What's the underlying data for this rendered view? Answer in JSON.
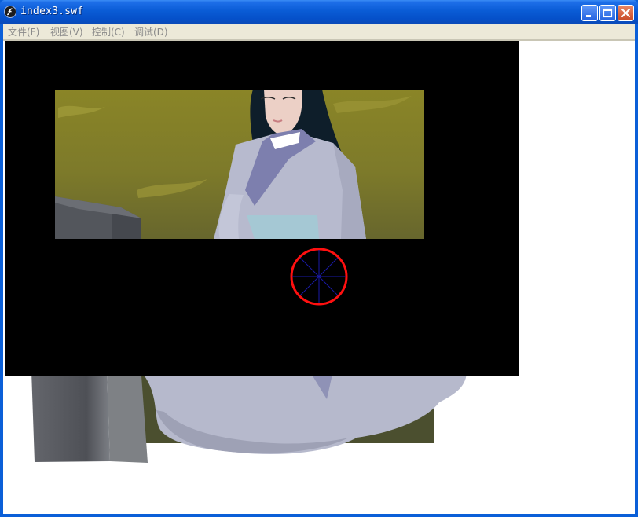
{
  "window": {
    "title": "index3.swf",
    "controls": {
      "minimize": "minimize-icon",
      "maximize": "maximize-icon",
      "close": "close-icon"
    }
  },
  "menu": {
    "items": [
      {
        "label": "文件(F)"
      },
      {
        "label": "视图(V)"
      },
      {
        "label": "控制(C)"
      },
      {
        "label": "调试(D)"
      }
    ]
  },
  "stage": {
    "background": "#000000",
    "scene": "woman in lavender robe sitting beside a gray stone, grassy olive background",
    "cursor_icon": "red-circle-crosshair-icon",
    "colors": {
      "grass": "#8f8a2a",
      "robe": "#b7bace",
      "robe_shadow": "#9fa2b6",
      "collar": "#7e80ae",
      "sash": "#a5c8d4",
      "hair": "#0e1e2a",
      "skin": "#ebcfc4",
      "stone": "#5d6066",
      "cursor_ring": "#ff1010",
      "cursor_spokes": "#1a1aa8"
    }
  }
}
